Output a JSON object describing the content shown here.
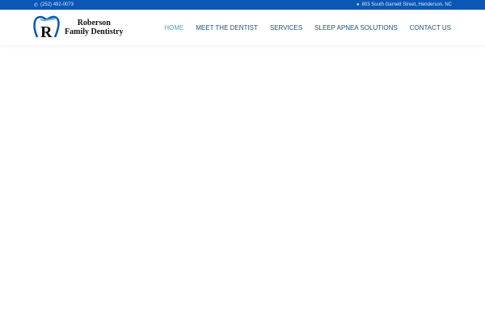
{
  "topbar": {
    "phone": "(252) 492-0073",
    "address": "803 South Garnett Street, Henderson, NC"
  },
  "logo": {
    "line1": "Roberson",
    "line2": "Family Dentistry",
    "letter": "R"
  },
  "nav": [
    {
      "label": "HOME",
      "active": true
    },
    {
      "label": "MEET THE DENTIST"
    },
    {
      "label": "SERVICES"
    },
    {
      "label": "SLEEP APNEA SOLUTIONS"
    },
    {
      "label": "CONTACT US"
    }
  ],
  "colors": {
    "topbar": "#0b57b5",
    "nav": "#1f4e7d",
    "active": "#4ba3c6"
  }
}
